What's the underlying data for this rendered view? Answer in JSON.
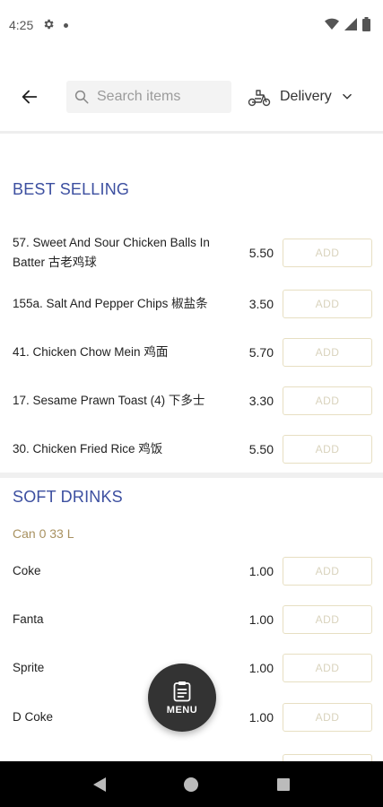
{
  "status_bar": {
    "time": "4:25"
  },
  "header": {
    "search_placeholder": "Search items",
    "delivery_label": "Delivery"
  },
  "sections": [
    {
      "title": "BEST SELLING",
      "items": [
        {
          "name": "57. Sweet And Sour Chicken Balls In Batter 古老鸡球",
          "price": "5.50",
          "add_label": "ADD"
        },
        {
          "name": "155a. Salt And Pepper Chips 椒盐条",
          "price": "3.50",
          "add_label": "ADD"
        },
        {
          "name": "41. Chicken Chow Mein 鸡面",
          "price": "5.70",
          "add_label": "ADD"
        },
        {
          "name": "17. Sesame Prawn Toast (4) 下多士",
          "price": "3.30",
          "add_label": "ADD"
        },
        {
          "name": "30. Chicken Fried Rice 鸡饭",
          "price": "5.50",
          "add_label": "ADD"
        }
      ]
    },
    {
      "title": "SOFT DRINKS",
      "subtitle": "Can 0 33 L",
      "items": [
        {
          "name": "Coke",
          "price": "1.00",
          "add_label": "ADD"
        },
        {
          "name": "Fanta",
          "price": "1.00",
          "add_label": "ADD"
        },
        {
          "name": "Sprite",
          "price": "1.00",
          "add_label": "ADD"
        },
        {
          "name": "D Coke",
          "price": "1.00",
          "add_label": "ADD"
        }
      ]
    }
  ],
  "fab": {
    "label": "MENU"
  },
  "colors": {
    "section_title": "#3c4fa0",
    "subtitle": "#a89160",
    "add_border": "#e7dfc2",
    "fab": "#333333"
  }
}
